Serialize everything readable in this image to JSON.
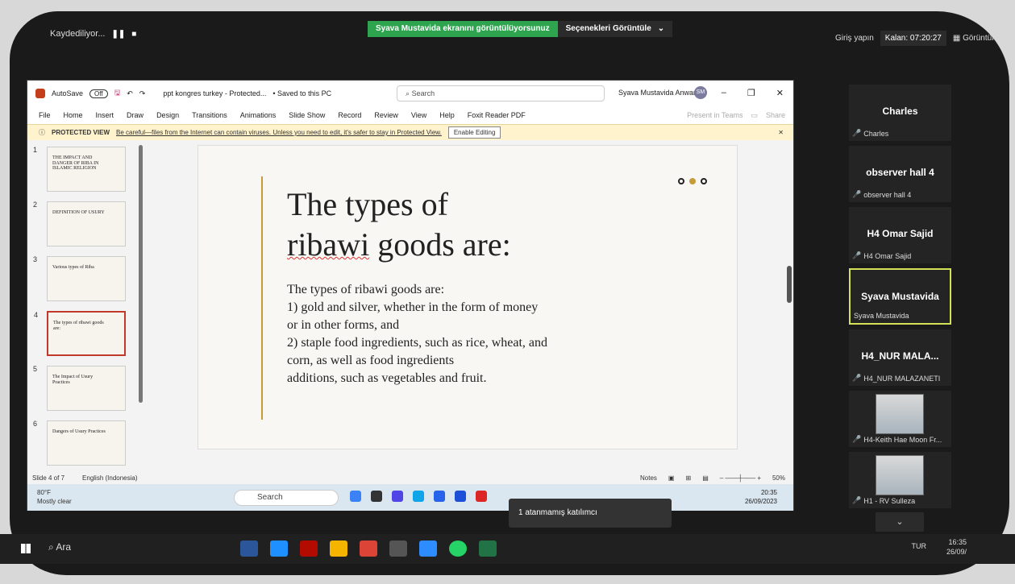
{
  "zoom": {
    "recording": "Kaydediliyor...",
    "banner_view": "Syava Mustavida ekranını görüntülüyorsunuz",
    "banner_options": "Seçenekleri Görüntüle",
    "login": "Giriş yapın",
    "remaining": "Kalan: 07:20:27",
    "view": "Görüntüle",
    "tooltip": "1 atanmamış katılımcı"
  },
  "ppt": {
    "autosave": "AutoSave",
    "autosave_state": "Off",
    "filename": "ppt kongres turkey - Protected...",
    "saved": "• Saved to this PC",
    "search_placeholder": "Search",
    "user": "Syava Mustavida Anwar",
    "initials": "SM",
    "menu": [
      "File",
      "Home",
      "Insert",
      "Draw",
      "Design",
      "Transitions",
      "Animations",
      "Slide Show",
      "Record",
      "Review",
      "View",
      "Help",
      "Foxit Reader PDF"
    ],
    "present": "Present in Teams",
    "share": "Share",
    "protected_title": "PROTECTED VIEW",
    "protected_msg": "Be careful—files from the Internet can contain viruses. Unless you need to edit, it's safer to stay in Protected View.",
    "enable": "Enable Editing",
    "thumbs": [
      {
        "n": "1",
        "t": "THE IMPACT AND DANGER OF RIBA IN ISLAMIC RELIGION"
      },
      {
        "n": "2",
        "t": "DEFINITION OF USURY"
      },
      {
        "n": "3",
        "t": "Various types of Riba"
      },
      {
        "n": "4",
        "t": "The types of ribawi goods are:"
      },
      {
        "n": "5",
        "t": "The Impact of Usury Practices"
      },
      {
        "n": "6",
        "t": "Dangers of Usury Practices"
      }
    ],
    "slide_title_1": "The types of",
    "slide_title_2": "ribawi",
    "slide_title_3": " goods are:",
    "slide_body": "The types of ribawi goods are:\n1) gold and silver, whether in the form of money\nor in other forms, and\n2) staple food ingredients, such as rice, wheat, and\ncorn, as well as food ingredients\nadditions, such as vegetables and fruit.",
    "status_slide": "Slide 4 of 7",
    "status_lang": "English (Indonesia)",
    "notes": "Notes",
    "zoom_pct": "50%",
    "temp": "80°F",
    "weather": "Mostly clear",
    "task_search": "Search",
    "time": "20:35",
    "date": "26/09/2023"
  },
  "participants": [
    {
      "name": "Charles",
      "label": "Charles"
    },
    {
      "name": "observer hall 4",
      "label": "observer hall 4"
    },
    {
      "name": "H4 Omar Sajid",
      "label": "H4 Omar Sajid"
    },
    {
      "name": "Syava Mustavida",
      "label": "Syava Mustavida"
    },
    {
      "name": "H4_NUR MALA...",
      "label": "H4_NUR MALAZANETI"
    },
    {
      "name": "",
      "label": "H4-Keith Hae Moon Fr..."
    },
    {
      "name": "",
      "label": "H1 - RV Sulleza"
    }
  ],
  "win": {
    "search": "Ara",
    "lang": "TUR",
    "time": "16:35",
    "date": "26/09/"
  }
}
